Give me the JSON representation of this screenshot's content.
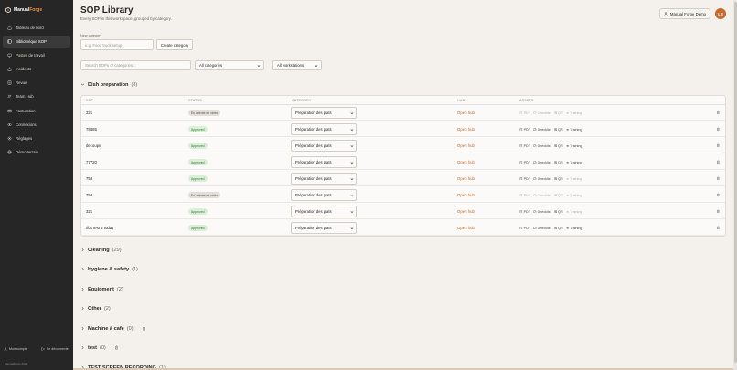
{
  "brand": {
    "name_part1": "Manual",
    "name_part2": "Forge"
  },
  "sidebar": {
    "items": [
      {
        "label": "Tableau de bord",
        "icon": "home-icon",
        "active": false
      },
      {
        "label": "Bibliothèque SOP",
        "icon": "book-icon",
        "active": true
      },
      {
        "label": "Postes de travail",
        "icon": "workstation-icon",
        "active": false
      },
      {
        "label": "Incidents",
        "icon": "alert-icon",
        "active": false
      },
      {
        "label": "Revue",
        "icon": "review-icon",
        "active": false
      },
      {
        "label": "Team Hub",
        "icon": "team-icon",
        "active": false
      },
      {
        "label": "Facturation",
        "icon": "billing-icon",
        "active": false
      },
      {
        "label": "Connexions",
        "icon": "link-icon",
        "active": false
      },
      {
        "label": "Réglages",
        "icon": "settings-icon",
        "active": false
      },
      {
        "label": "Démo terrain",
        "icon": "globe-icon",
        "active": false
      }
    ],
    "account_label": "Mon compte",
    "logout_label": "Se déconnecter",
    "copyright": "ManualForge 2026"
  },
  "header": {
    "title": "SOP Library",
    "subtitle": "Every SOP in this workspace, grouped by category.",
    "user_name": "Manual Forge Démo",
    "avatar_initials": "LB"
  },
  "new_category": {
    "label": "New category",
    "placeholder": "e.g. Food truck setup",
    "button": "Create category"
  },
  "filters": {
    "search_placeholder": "Search SOPs or categories...",
    "category_filter": "All categories",
    "workstation_filter": "All workstations"
  },
  "open_group": {
    "name": "Dish preparation",
    "count": "(8)",
    "columns": [
      "SOP",
      "STATUS",
      "CATEGORY",
      "HUB",
      "ASSETS"
    ],
    "rows": [
      {
        "name": "321",
        "status": "En attente de vidéo",
        "status_kind": "draft",
        "category": "Préparation des plats",
        "hub": "Open hub",
        "enabled": false
      },
      {
        "name": "78485",
        "status": "Approved",
        "status_kind": "approved",
        "category": "Préparation des plats",
        "hub": "Open hub",
        "enabled": true
      },
      {
        "name": "decoupe",
        "status": "Approved",
        "status_kind": "approved",
        "category": "Préparation des plats",
        "hub": "Open hub",
        "enabled": true
      },
      {
        "name": "77720",
        "status": "Approved",
        "status_kind": "approved",
        "category": "Préparation des plats",
        "hub": "Open hub",
        "enabled": true
      },
      {
        "name": "753",
        "status": "Approved",
        "status_kind": "approved",
        "category": "Préparation des plats",
        "hub": "Open hub",
        "enabled": true
      },
      {
        "name": "753",
        "status": "En attente de vidéo",
        "status_kind": "draft",
        "category": "Préparation des plats",
        "hub": "Open hub",
        "enabled": false
      },
      {
        "name": "321",
        "status": "Approved",
        "status_kind": "approved",
        "category": "Préparation des plats",
        "hub": "Open hub",
        "enabled": true
      },
      {
        "name": "ribs test 2 today",
        "status": "Approved",
        "status_kind": "approved",
        "category": "Préparation des plats",
        "hub": "Open hub",
        "enabled": true
      }
    ],
    "asset_labels": {
      "pdf": "PDF",
      "checklist": "Checklist",
      "qr": "QR",
      "training": "Training"
    }
  },
  "collapsed_groups": [
    {
      "name": "Cleaning",
      "count": "(29)",
      "deletable": false
    },
    {
      "name": "Hygiene & safety",
      "count": "(1)",
      "deletable": false
    },
    {
      "name": "Equipment",
      "count": "(2)",
      "deletable": false
    },
    {
      "name": "Other",
      "count": "(2)",
      "deletable": false
    },
    {
      "name": "Machine à café",
      "count": "(0)",
      "deletable": true
    },
    {
      "name": "test",
      "count": "(0)",
      "deletable": true
    },
    {
      "name": "TEST SCREEN RECORDING",
      "count": "(1)",
      "deletable": false
    }
  ],
  "colors": {
    "accent": "#c66a28",
    "sidebar_bg": "#262626",
    "page_bg": "#f4f1ec",
    "approved": "#2f7a33"
  }
}
